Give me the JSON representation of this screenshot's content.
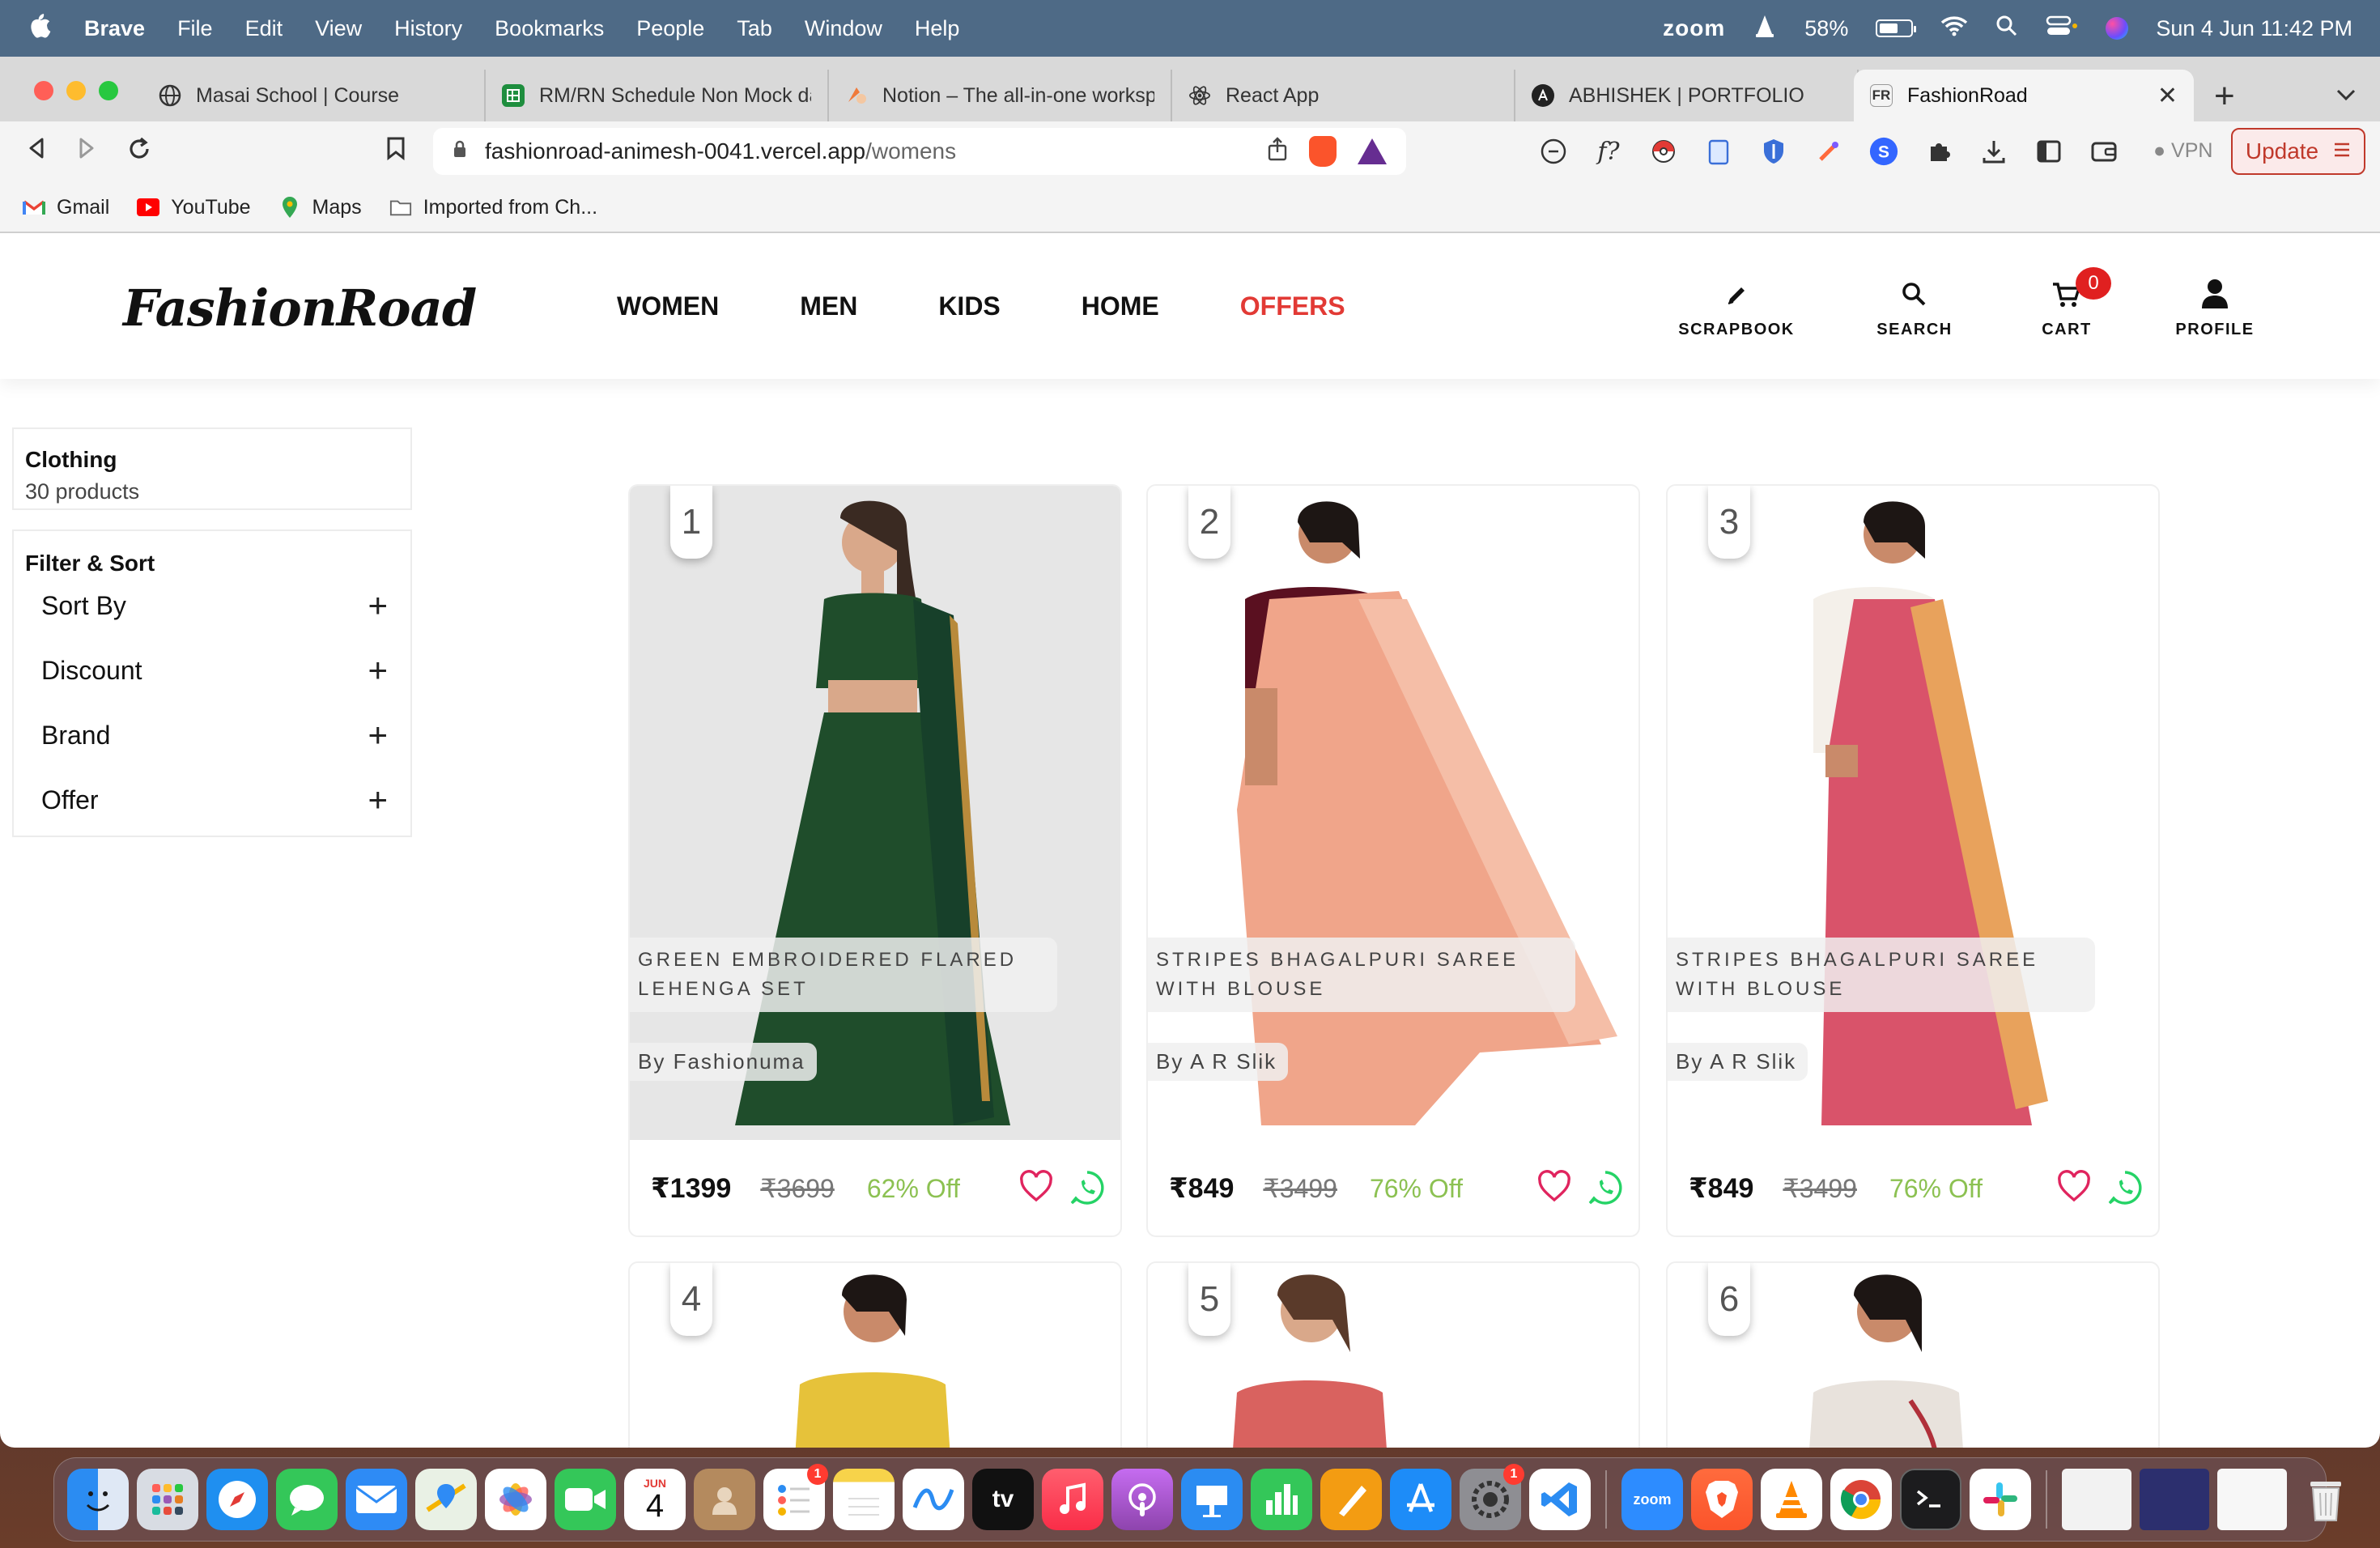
{
  "menubar": {
    "app": "Brave",
    "items": [
      "File",
      "Edit",
      "View",
      "History",
      "Bookmarks",
      "People",
      "Tab",
      "Window",
      "Help"
    ],
    "zoom": "zoom",
    "battery": "58%",
    "datetime": "Sun 4 Jun  11:42 PM"
  },
  "tabs": [
    {
      "label": "Masai School | Course",
      "favicon": "globe-icon"
    },
    {
      "label": "RM/RN Schedule Non Mock da",
      "favicon": "sheets-icon"
    },
    {
      "label": "Notion – The all-in-one worksp",
      "favicon": "notion-icon"
    },
    {
      "label": "React App",
      "favicon": "react-icon"
    },
    {
      "label": "ABHISHEK | PORTFOLIO",
      "favicon": "portfolio-icon"
    },
    {
      "label": "FashionRoad",
      "favicon": "fr-icon",
      "active": true
    }
  ],
  "tab_favicon_text": {
    "fr": "FR"
  },
  "address": {
    "host": "fashionroad-animesh-0041.vercel.app",
    "path": "/womens"
  },
  "vpn": "VPN",
  "update_label": "Update",
  "bookmarks": [
    "Gmail",
    "YouTube",
    "Maps",
    "Imported from Ch..."
  ],
  "site": {
    "logo": "FashionRoad",
    "nav": [
      "WOMEN",
      "MEN",
      "KIDS",
      "HOME",
      "OFFERS"
    ],
    "actions": {
      "scrapbook": "SCRAPBOOK",
      "search": "SEARCH",
      "cart": "CART",
      "profile": "PROFILE"
    },
    "cart_count": "0",
    "accent": "#e23a35"
  },
  "sidebar": {
    "category": "Clothing",
    "count": "30 products",
    "filter_title": "Filter & Sort",
    "filters": [
      "Sort By",
      "Discount",
      "Brand",
      "Offer"
    ]
  },
  "products": [
    {
      "rank": "1",
      "name": "GREEN EMBROIDERED FLARED LEHENGA SET",
      "brand": "By Fashionuma",
      "price": "₹1399",
      "mrp": "₹3699",
      "off": "62% Off",
      "color": "#1f4d2b"
    },
    {
      "rank": "2",
      "name": "STRIPES BHAGALPURI SAREE WITH BLOUSE",
      "brand": "By A R Slik",
      "price": "₹849",
      "mrp": "₹3499",
      "off": "76% Off",
      "color": "#f0a58a"
    },
    {
      "rank": "3",
      "name": "STRIPES BHAGALPURI SAREE WITH BLOUSE",
      "brand": "By A R Slik",
      "price": "₹849",
      "mrp": "₹3499",
      "off": "76% Off",
      "color": "#d9536a"
    },
    {
      "rank": "4",
      "color": "#e6c23a"
    },
    {
      "rank": "5",
      "color": "#d9625f"
    },
    {
      "rank": "6",
      "color": "#e8e2dc"
    }
  ],
  "dock": {
    "calendar_month": "JUN",
    "calendar_day": "4",
    "tv_label": "tv",
    "zoom_label": "zoom",
    "badges": {
      "reminders": "1",
      "settings": "1"
    }
  }
}
